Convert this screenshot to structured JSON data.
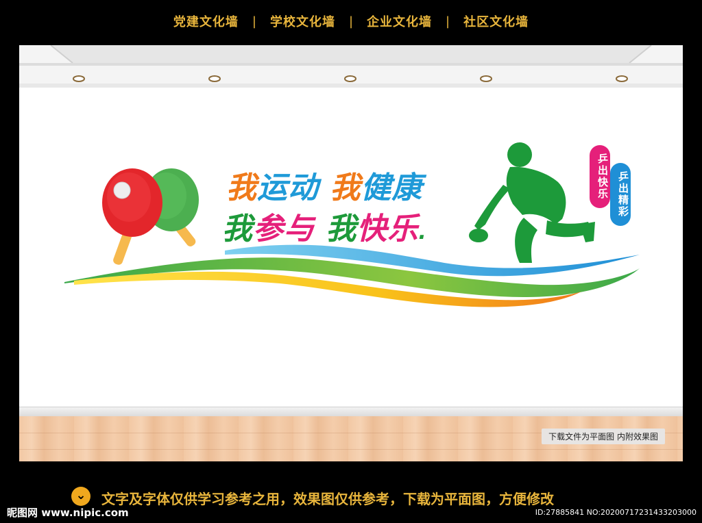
{
  "nav": {
    "items": [
      "党建文化墙",
      "学校文化墙",
      "企业文化墙",
      "社区文化墙"
    ],
    "separator": "|"
  },
  "slogan": {
    "line1": [
      {
        "text": "我",
        "color": "#f07a1a"
      },
      {
        "text": "运动",
        "color": "#1f9ad8"
      },
      {
        "text": "我",
        "color": "#f07a1a"
      },
      {
        "text": "健康",
        "color": "#1f9ad8"
      }
    ],
    "line2": [
      {
        "text": "我",
        "color": "#1d9a3a"
      },
      {
        "text": "参与",
        "color": "#e5207a"
      },
      {
        "text": "我",
        "color": "#1d9a3a"
      },
      {
        "text": "快乐",
        "color": "#e5207a"
      }
    ]
  },
  "pills": {
    "pink": "乒出快乐",
    "blue": "乒出精彩"
  },
  "notice": "下载文件为平面图 内附效果图",
  "footer": {
    "icon": "chevron-down-icon",
    "message": "文字及字体仅供学习参考之用，效果图仅供参考，下载为平面图，方便修改",
    "logo": "昵图网 www.nipic.com",
    "id": "ID:27885841 NO:20200717231433203000"
  },
  "colors": {
    "accent": "#e8b53c",
    "orange": "#f07a1a",
    "blue": "#1f9ad8",
    "green": "#1d9a3a",
    "pink": "#e5207a",
    "paddle_red": "#e3262b",
    "paddle_green": "#4caf50"
  }
}
